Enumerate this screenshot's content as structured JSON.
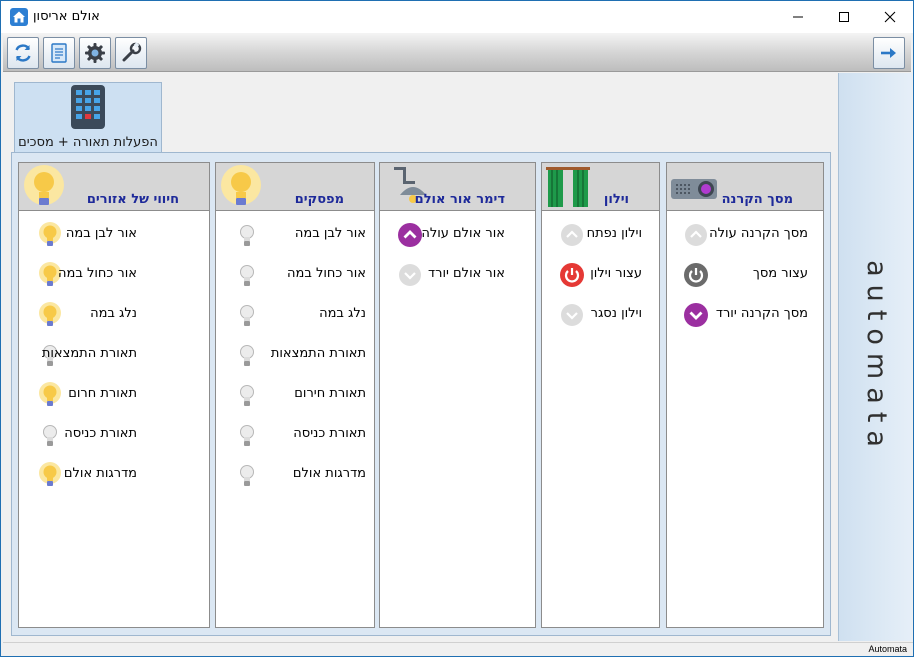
{
  "window": {
    "title": "אולם אריסון"
  },
  "toolbar": {
    "icons": [
      "refresh-icon",
      "document-icon",
      "settings-icon",
      "tools-icon",
      "next-arrow-icon"
    ]
  },
  "tab": {
    "label": "הפעלות תאורה + מסכים"
  },
  "side_panel": {
    "brand": "automata"
  },
  "status": {
    "text": "Automata"
  },
  "columns": {
    "screen": {
      "title": "מסך הקרנה",
      "items": [
        {
          "label": "מסך הקרנה עולה",
          "icon": "chevron-up-icon"
        },
        {
          "label": "עצור מסך",
          "icon": "power-icon"
        },
        {
          "label": "מסך הקרנה יורד",
          "icon": "chevron-down-icon"
        }
      ]
    },
    "curtain": {
      "title": "וילון",
      "items": [
        {
          "label": "וילון נפתח",
          "icon": "chevron-up-icon"
        },
        {
          "label": "עצור וילון",
          "icon": "power-icon"
        },
        {
          "label": "וילון נסגר",
          "icon": "chevron-down-icon"
        }
      ]
    },
    "dimmer": {
      "title": "דימר אור אולם",
      "items": [
        {
          "label": "אור אולם עולה",
          "icon": "chevron-up-icon"
        },
        {
          "label": "אור אולם יורד",
          "icon": "chevron-down-icon"
        }
      ]
    },
    "switches": {
      "title": "מפסקים",
      "items": [
        {
          "label": "אור לבן במה",
          "icon": "bulb-off-icon"
        },
        {
          "label": "אור כחול במה",
          "icon": "bulb-off-icon"
        },
        {
          "label": "נלג במה",
          "icon": "bulb-off-icon"
        },
        {
          "label": "תאורת התמצאות",
          "icon": "bulb-off-icon"
        },
        {
          "label": "תאורת חירום",
          "icon": "bulb-off-icon"
        },
        {
          "label": "תאורת כניסה",
          "icon": "bulb-off-icon"
        },
        {
          "label": "מדרגות אולם",
          "icon": "bulb-off-icon"
        }
      ]
    },
    "zones": {
      "title": "חיווי של אזורים",
      "items": [
        {
          "label": "אור לבן במה",
          "icon": "bulb-on-icon"
        },
        {
          "label": "אור כחול במה",
          "icon": "bulb-on-icon"
        },
        {
          "label": "נלג במה",
          "icon": "bulb-on-icon"
        },
        {
          "label": "תאורת התמצאות",
          "icon": "bulb-off-icon"
        },
        {
          "label": "תאורת חרום",
          "icon": "bulb-on-icon"
        },
        {
          "label": "תאורת כניסה",
          "icon": "bulb-off-icon"
        },
        {
          "label": "מדרגות אולם",
          "icon": "bulb-on-icon"
        }
      ]
    }
  },
  "colors": {
    "accent_purple": "#9b2fa0",
    "stop_red": "#e53935",
    "stop_gray": "#6b6b6b",
    "title_blue": "#1e2a9a",
    "bulb_on": "#f7c948"
  }
}
